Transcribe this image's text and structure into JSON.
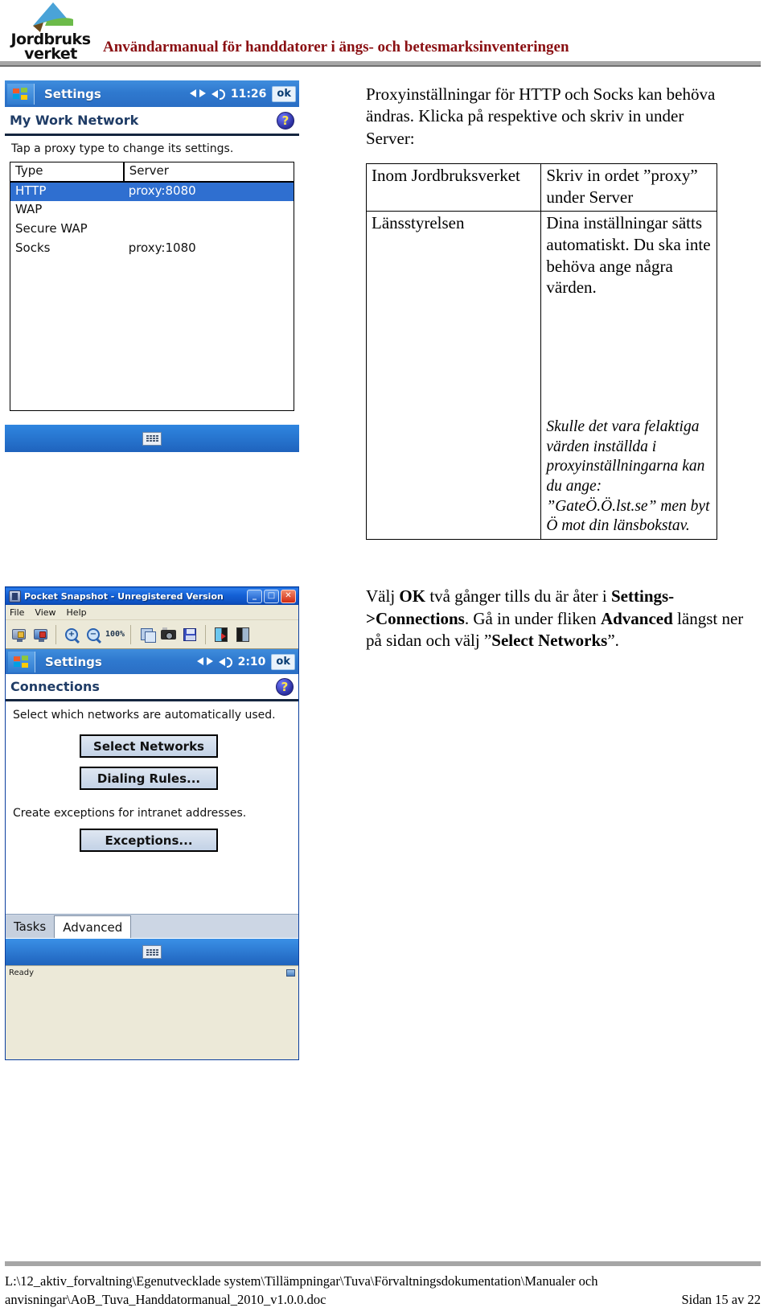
{
  "header": {
    "logo_word1": "Jordbruks",
    "logo_word2": "verket",
    "logo_icon": "jordbruksverket-logo",
    "title": "Användarmanual för handdatorer i ängs- och betesmarksinventeringen"
  },
  "shot1": {
    "titlebar": {
      "start_icon": "windows-flag-icon",
      "app_title": "Settings",
      "network_icon": "network-connection-icon",
      "speaker_icon": "speaker-icon",
      "clock": "11:26",
      "ok_label": "ok"
    },
    "page_title": "My Work Network",
    "help_icon": "help-question-icon",
    "hint": "Tap a proxy type to change its settings.",
    "table": {
      "headers": [
        "Type",
        "Server"
      ],
      "rows": [
        {
          "type": "HTTP",
          "server": "proxy:8080",
          "selected": true
        },
        {
          "type": "WAP",
          "server": "",
          "selected": false
        },
        {
          "type": "Secure WAP",
          "server": "",
          "selected": false
        },
        {
          "type": "Socks",
          "server": "proxy:1080",
          "selected": false
        }
      ]
    },
    "softbar_icon": "keyboard-icon"
  },
  "body": {
    "intro": "Proxyinställningar för HTTP och Socks kan behöva ändras. Klicka på respektive och skriv in under Server:",
    "table": {
      "rows": [
        {
          "left": "Inom Jordbruksverket",
          "right": "Skriv in ordet ”proxy” under Server"
        },
        {
          "left": "Länsstyrelsen",
          "right": "Dina inställningar sätts automatiskt. Du ska inte behöva ange några värden.",
          "note": "Skulle det vara felaktiga värden inställda i proxyinställningarna kan du ange: ”GateÖ.Ö.lst.se” men byt Ö mot din länsbokstav."
        }
      ]
    },
    "instruction": {
      "line1_a": "Välj ",
      "line1_b": "OK",
      "line1_c": " två gånger tills du är åter i ",
      "line1_d": "Settings->Connections",
      "line1_e": ".",
      "line2_a": "Gå in under fliken ",
      "line2_b": "Advanced",
      "line2_c": " längst ner på sidan och välj ”",
      "line2_d": "Select Networks",
      "line2_e": "”."
    }
  },
  "shot2": {
    "window_title": "Pocket Snapshot - Unregistered Version",
    "app_icon": "pocket-snapshot-icon",
    "window_buttons": {
      "minimize": "_",
      "maximize": "□",
      "close": "✕"
    },
    "menus": [
      "File",
      "View",
      "Help"
    ],
    "toolbar_icons": [
      "connect-device-icon",
      "disconnect-device-icon",
      "zoom-in-icon",
      "zoom-out-icon",
      "zoom-100-icon",
      "copy-icon",
      "capture-camera-icon",
      "save-icon",
      "device-rotate-icon",
      "device-layout-icon"
    ],
    "zoom_level": "100%",
    "pda": {
      "titlebar": {
        "start_icon": "windows-flag-icon",
        "app_title": "Settings",
        "network_icon": "network-connection-icon",
        "speaker_icon": "speaker-icon",
        "clock": "2:10",
        "ok_label": "ok"
      },
      "page_title": "Connections",
      "help_icon": "help-question-icon",
      "text1": "Select which networks are automatically used.",
      "btn_select_networks": "Select Networks",
      "btn_dialing_rules": "Dialing Rules...",
      "text2": "Create exceptions for intranet addresses.",
      "btn_exceptions": "Exceptions...",
      "tabs": [
        {
          "label": "Tasks",
          "active": false
        },
        {
          "label": "Advanced",
          "active": true
        }
      ],
      "softbar_icon": "keyboard-icon"
    },
    "status_text": "Ready",
    "status_icon": "connected-device-icon"
  },
  "footer": {
    "path_line1": "L:\\12_aktiv_forvaltning\\Egenutvecklade system\\Tillämpningar\\Tuva\\Förvaltningsdokumentation\\Manualer och",
    "path_line2": "anvisningar\\AoB_Tuva_Handdatormanual_2010_v1.0.0.doc",
    "page_number": "Sidan 15 av 22"
  }
}
